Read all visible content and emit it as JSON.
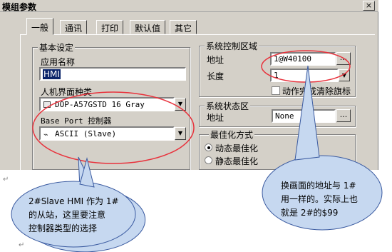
{
  "window": {
    "title": "模组参数",
    "close_glyph": "×"
  },
  "tabs": [
    "一般",
    "通讯",
    "打印",
    "默认值",
    "其它"
  ],
  "basic": {
    "group_title": "基本设定",
    "app_name_label": "应用名称",
    "app_name_value": "HMI",
    "hmi_type_label": "人机界面种类",
    "hmi_type_value": "DOP-A57GSTD 16 Gray",
    "base_port_label": "Base Port 控制器",
    "base_port_value": "ASCII (Slave)"
  },
  "sys_control": {
    "group_title": "系统控制区域",
    "address_label": "地址",
    "address_value": "1@W40100",
    "length_label": "长度",
    "length_value": "1",
    "checkbox_label": "动作完成清除旗标",
    "browse_label": "..."
  },
  "sys_status": {
    "group_title": "系统状态区",
    "address_label": "地址",
    "address_value": "None",
    "browse_label": "..."
  },
  "optimize": {
    "group_title": "最佳化方式",
    "options": [
      "动态最佳化",
      "静态最佳化"
    ],
    "selected": "动态最佳化"
  },
  "callout_left": {
    "lines": [
      "2#Slave HMI 作为 1#",
      "的从站，这里要注意",
      "控制器类型的选择"
    ]
  },
  "callout_right": {
    "lines": [
      "换画面的地址与 1#",
      "用一样的。实际上也",
      "就是 2#的$99"
    ]
  },
  "colors": {
    "annotation_ellipse": "#e8323c",
    "callout_fill": "#c6d8f0",
    "callout_border": "#3a5aa0",
    "selection": "#0a246a"
  },
  "paragraph_mark": "↵"
}
